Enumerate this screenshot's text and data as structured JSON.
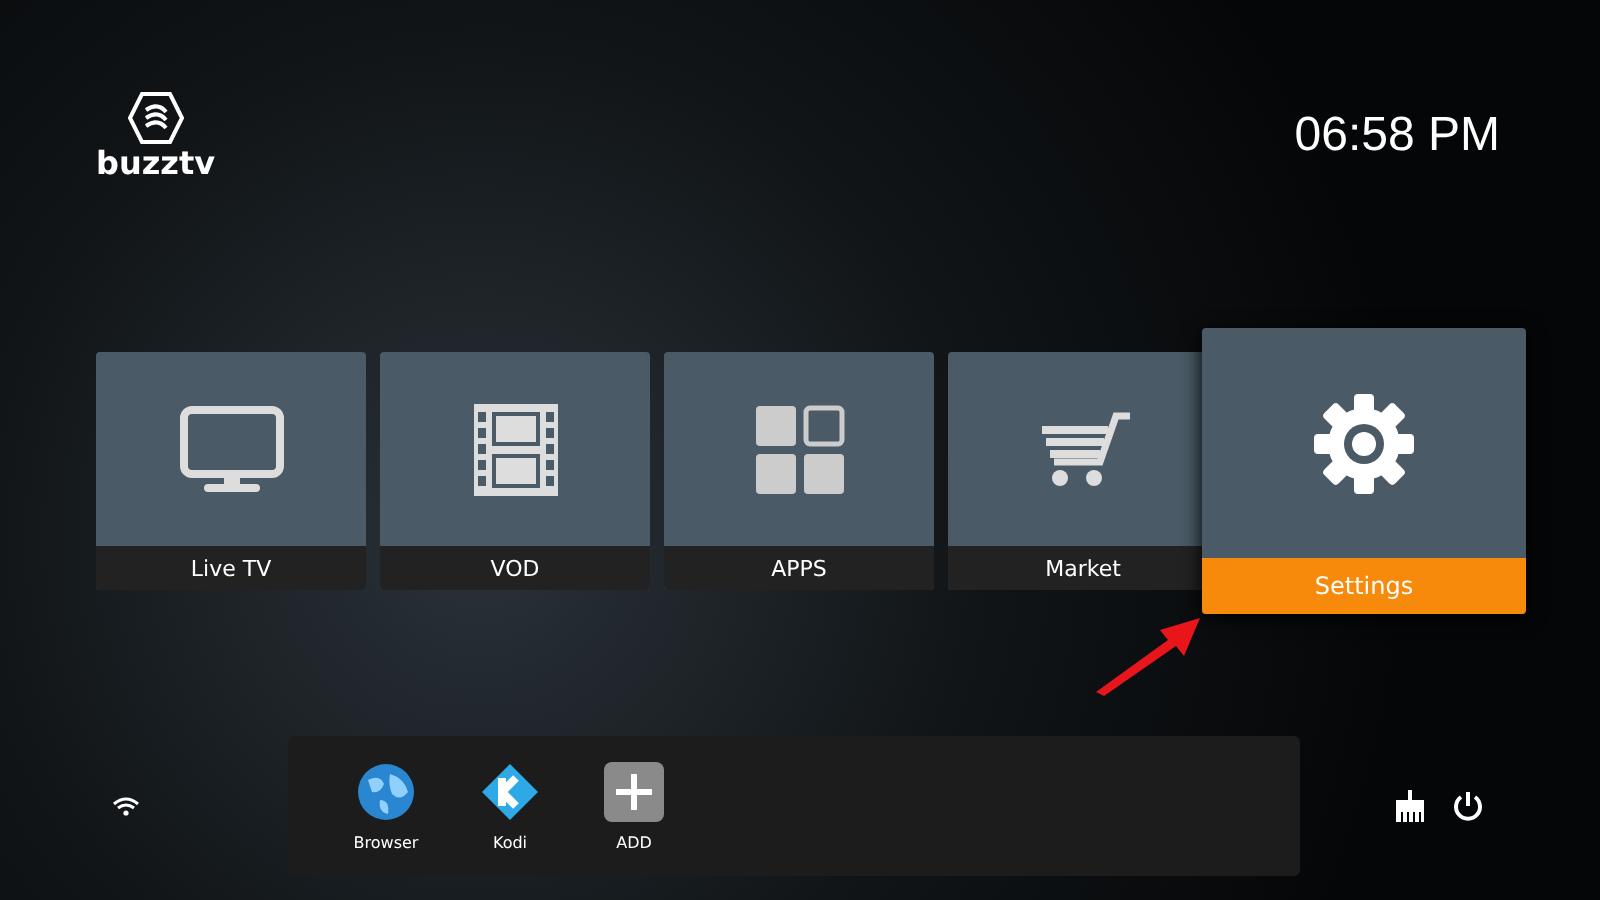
{
  "header": {
    "logo_text": "buzztv",
    "clock": "06:58 PM"
  },
  "tiles": [
    {
      "label": "Live TV",
      "kind": "tv",
      "selected": false
    },
    {
      "label": "VOD",
      "kind": "film",
      "selected": false
    },
    {
      "label": "APPS",
      "kind": "apps",
      "selected": false
    },
    {
      "label": "Market",
      "kind": "cart",
      "selected": false
    },
    {
      "label": "Settings",
      "kind": "gear",
      "selected": true
    }
  ],
  "dock": [
    {
      "label": "Browser",
      "kind": "globe"
    },
    {
      "label": "Kodi",
      "kind": "kodi"
    },
    {
      "label": "ADD",
      "kind": "add"
    }
  ]
}
